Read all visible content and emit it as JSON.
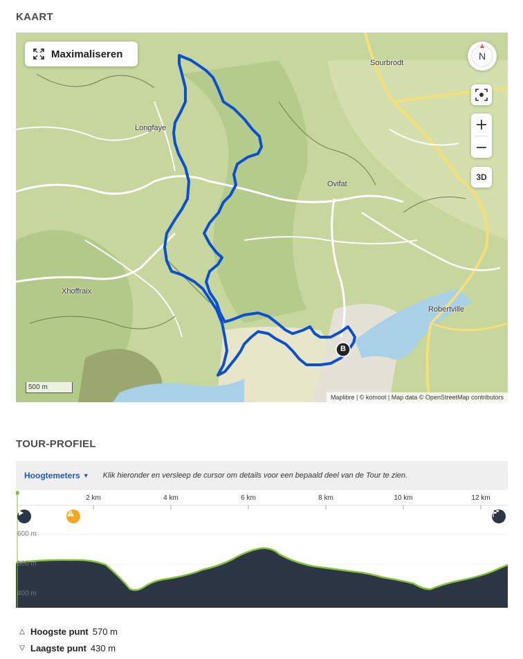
{
  "map_section": {
    "title": "KAART",
    "maximize_label": "Maximaliseren",
    "compass_label": "N",
    "three_d_label": "3D",
    "zoom_in_label": "+",
    "zoom_out_label": "−",
    "scale_label": "500 m",
    "attribution": "Maplibre | © komoot | Map data © OpenStreetMap contributors",
    "towns": [
      "Sourbrodt",
      "Longfaye",
      "Ovifat",
      "Xhoffraix",
      "Robertville"
    ],
    "end_marker_label": "B"
  },
  "profile_section": {
    "title": "TOUR-PROFIEL",
    "metric_selected": "Hoogtemeters",
    "hint": "Klik hieronder en versleep de cursor om details voor een bepaald deel van de Tour te zien.",
    "km_ticks": [
      "2 km",
      "4 km",
      "6 km",
      "8 km",
      "10 km",
      "12 km"
    ],
    "elevation_ticks": [
      "600 m",
      "500 m",
      "400 m"
    ]
  },
  "stats": {
    "highest_label": "Hoogste punt",
    "highest_value": "570 m",
    "lowest_label": "Laagste punt",
    "lowest_value": "430 m"
  },
  "colors": {
    "route": "#0a4fd1",
    "profile_fill": "#2c3645",
    "profile_line": "#86c23b",
    "accent_blue": "#1d58c2",
    "warning": "#f5a623"
  }
}
